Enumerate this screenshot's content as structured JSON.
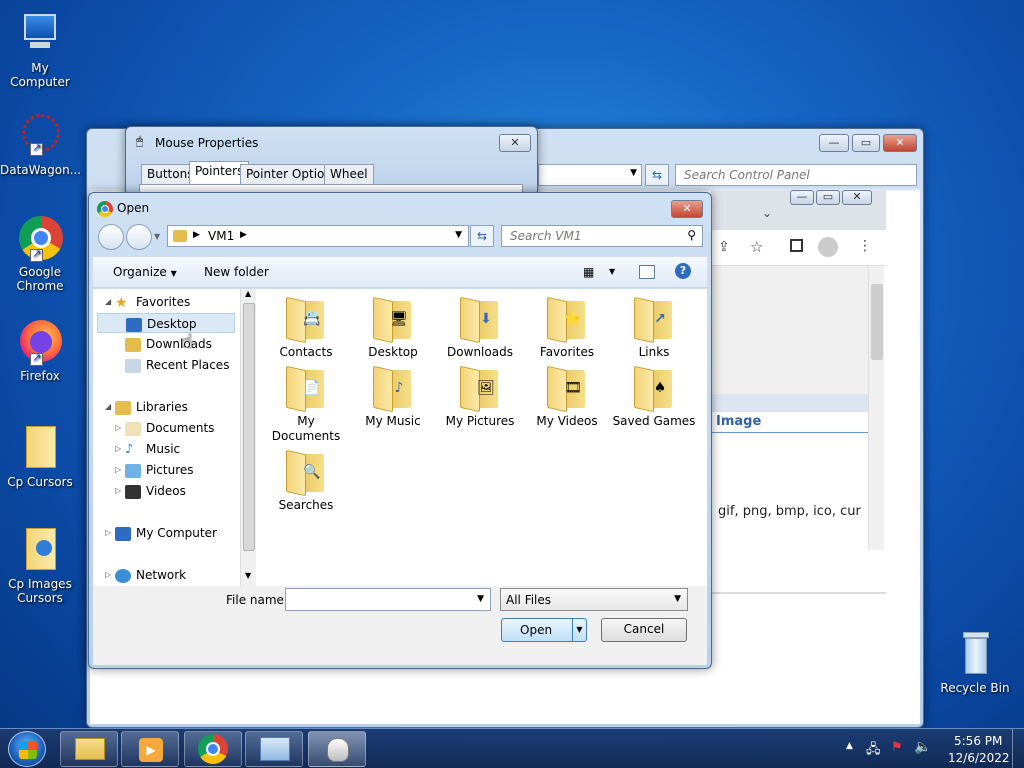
{
  "desktop": {
    "icons": [
      {
        "label": "My Computer"
      },
      {
        "label": "DataWagon..."
      },
      {
        "label": "Google Chrome"
      },
      {
        "label": "Firefox"
      },
      {
        "label": "Cp Cursors"
      },
      {
        "label": "Cp Images Cursors"
      },
      {
        "label": "Recycle Bin"
      }
    ]
  },
  "control_panel": {
    "search_placeholder": "Search Control Panel",
    "browser_text_image": "Image",
    "browser_text_formats": "gif, png, bmp, ico, cur"
  },
  "mouse_properties": {
    "title": "Mouse Properties",
    "tabs": [
      "Buttons",
      "Pointers",
      "Pointer Options",
      "Wheel"
    ],
    "active_tab": "Pointers"
  },
  "open_dialog": {
    "title": "Open",
    "path": "VM1",
    "search_placeholder": "Search VM1",
    "toolbar": {
      "organize": "Organize",
      "new_folder": "New folder"
    },
    "nav": {
      "favorites": "Favorites",
      "favorites_items": [
        "Desktop",
        "Downloads",
        "Recent Places"
      ],
      "libraries": "Libraries",
      "libraries_items": [
        "Documents",
        "Music",
        "Pictures",
        "Videos"
      ],
      "my_computer": "My Computer",
      "network": "Network"
    },
    "files": [
      {
        "label": "Contacts",
        "glyph": "📇"
      },
      {
        "label": "Desktop",
        "glyph": "🖥"
      },
      {
        "label": "Downloads",
        "glyph": "⬇"
      },
      {
        "label": "Favorites",
        "glyph": "⭐"
      },
      {
        "label": "Links",
        "glyph": "↗"
      },
      {
        "label": "My Documents",
        "glyph": "📄"
      },
      {
        "label": "My Music",
        "glyph": "♪"
      },
      {
        "label": "My Pictures",
        "glyph": "🖼"
      },
      {
        "label": "My Videos",
        "glyph": "🎞"
      },
      {
        "label": "Saved Games",
        "glyph": "♠"
      },
      {
        "label": "Searches",
        "glyph": "🔍"
      }
    ],
    "file_name_label": "File name:",
    "file_name_value": "",
    "file_type": "All Files",
    "open_button": "Open",
    "cancel_button": "Cancel"
  },
  "taskbar": {
    "time": "5:56 PM",
    "date": "12/6/2022"
  }
}
